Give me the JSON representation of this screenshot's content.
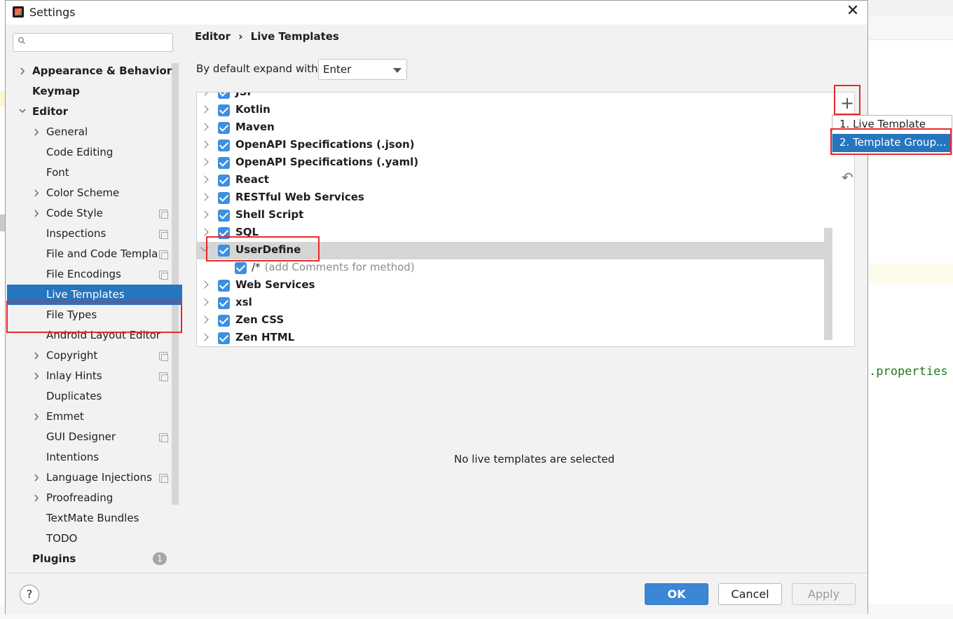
{
  "window": {
    "title": "Settings"
  },
  "search": {
    "placeholder": ""
  },
  "sidebar": {
    "items": [
      {
        "label": "Appearance & Behavior",
        "bold": true,
        "level": 0,
        "expandable": true,
        "expanded": false
      },
      {
        "label": "Keymap",
        "bold": true,
        "level": 0,
        "expandable": false
      },
      {
        "label": "Editor",
        "bold": true,
        "level": 0,
        "expandable": true,
        "expanded": true
      },
      {
        "label": "General",
        "level": 1,
        "expandable": true
      },
      {
        "label": "Code Editing",
        "level": 1
      },
      {
        "label": "Font",
        "level": 1
      },
      {
        "label": "Color Scheme",
        "level": 1,
        "expandable": true
      },
      {
        "label": "Code Style",
        "level": 1,
        "expandable": true,
        "project_icon": true
      },
      {
        "label": "Inspections",
        "level": 1,
        "project_icon": true
      },
      {
        "label": "File and Code Templa",
        "level": 1,
        "project_icon": true
      },
      {
        "label": "File Encodings",
        "level": 1,
        "project_icon": true
      },
      {
        "label": "Live Templates",
        "level": 1,
        "selected": true
      },
      {
        "label": "File Types",
        "level": 1
      },
      {
        "label": "Android Layout Editor",
        "level": 1
      },
      {
        "label": "Copyright",
        "level": 1,
        "expandable": true,
        "project_icon": true
      },
      {
        "label": "Inlay Hints",
        "level": 1,
        "expandable": true,
        "project_icon": true
      },
      {
        "label": "Duplicates",
        "level": 1
      },
      {
        "label": "Emmet",
        "level": 1,
        "expandable": true
      },
      {
        "label": "GUI Designer",
        "level": 1,
        "project_icon": true
      },
      {
        "label": "Intentions",
        "level": 1
      },
      {
        "label": "Language Injections",
        "level": 1,
        "expandable": true,
        "project_icon": true
      },
      {
        "label": "Proofreading",
        "level": 1,
        "expandable": true
      },
      {
        "label": "TextMate Bundles",
        "level": 1
      },
      {
        "label": "TODO",
        "level": 1
      },
      {
        "label": "Plugins",
        "bold": true,
        "level": 0,
        "badge": "1"
      }
    ]
  },
  "breadcrumb": {
    "part1": "Editor",
    "separator": "›",
    "part2": "Live Templates"
  },
  "expand": {
    "label": "By default expand with",
    "value": "Enter"
  },
  "templates": {
    "rows": [
      {
        "name": "JSP",
        "type": "group",
        "checked": true
      },
      {
        "name": "Kotlin",
        "type": "group",
        "checked": true
      },
      {
        "name": "Maven",
        "type": "group",
        "checked": true
      },
      {
        "name": "OpenAPI Specifications (.json)",
        "type": "group",
        "checked": true
      },
      {
        "name": "OpenAPI Specifications (.yaml)",
        "type": "group",
        "checked": true
      },
      {
        "name": "React",
        "type": "group",
        "checked": true
      },
      {
        "name": "RESTful Web Services",
        "type": "group",
        "checked": true
      },
      {
        "name": "Shell Script",
        "type": "group",
        "checked": true
      },
      {
        "name": "SQL",
        "type": "group",
        "checked": true
      },
      {
        "name": "UserDefine",
        "type": "group",
        "checked": true,
        "expanded": true
      },
      {
        "name": "/*",
        "hint": "(add Comments for method)",
        "type": "template",
        "checked": true
      },
      {
        "name": "Web Services",
        "type": "group",
        "checked": true
      },
      {
        "name": "xsl",
        "type": "group",
        "checked": true
      },
      {
        "name": "Zen CSS",
        "type": "group",
        "checked": true
      },
      {
        "name": "Zen HTML",
        "type": "group",
        "checked": true
      }
    ]
  },
  "toolbar": {
    "add": "+",
    "undo": "↶"
  },
  "popup": {
    "item1": "1. Live Template",
    "item2": "2. Template Group..."
  },
  "empty_message": "No live templates are selected",
  "footer": {
    "help": "?",
    "ok": "OK",
    "cancel": "Cancel",
    "apply": "Apply"
  },
  "background": {
    "code_text": ".properties"
  },
  "colors": {
    "selection": "#2675bf",
    "highlight_outline": "#e8292b",
    "checkbox": "#3d8fe0"
  }
}
